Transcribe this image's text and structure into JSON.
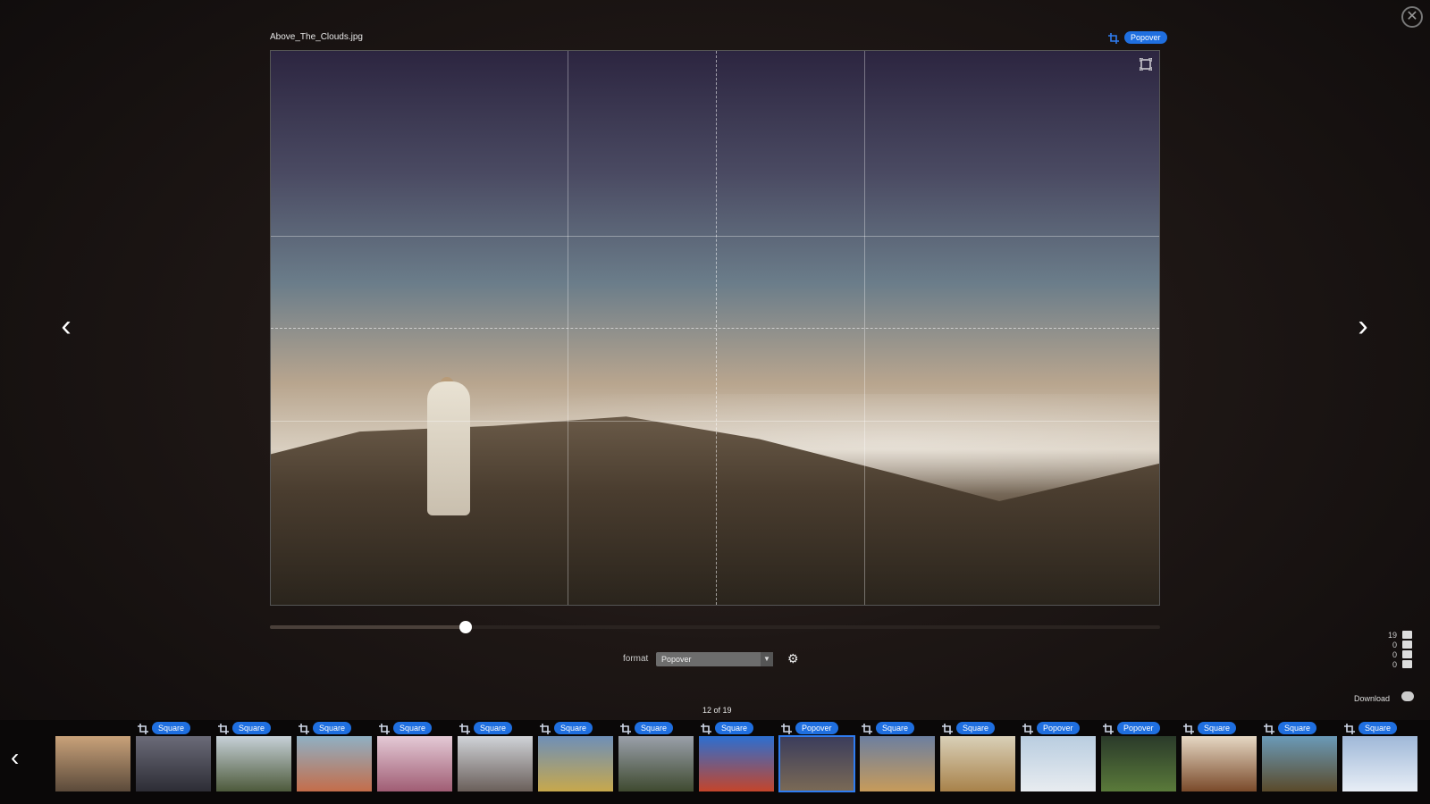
{
  "filename": "Above_The_Clouds.jpg",
  "current_format": "Popover",
  "format_label": "format",
  "format_select_value": "Popover",
  "zoom_value": 0.22,
  "stats": [
    {
      "count": "19",
      "icon": "image-icon"
    },
    {
      "count": "0",
      "icon": "audio-icon"
    },
    {
      "count": "0",
      "icon": "camera-icon"
    },
    {
      "count": "0",
      "icon": "document-icon"
    }
  ],
  "download_label": "Download",
  "counter": "12 of 19",
  "filmstrip": [
    {
      "tag": "",
      "colors": [
        "#c9a27a",
        "#5b4a3a"
      ]
    },
    {
      "tag": "Square",
      "colors": [
        "#6b6b78",
        "#2d2d35"
      ]
    },
    {
      "tag": "Square",
      "colors": [
        "#c7d1d8",
        "#4d5a3b"
      ]
    },
    {
      "tag": "Square",
      "colors": [
        "#8fb0c4",
        "#c46d4a"
      ]
    },
    {
      "tag": "Square",
      "colors": [
        "#e4cad6",
        "#a05d74"
      ]
    },
    {
      "tag": "Square",
      "colors": [
        "#d0d3d8",
        "#6a5f5a"
      ]
    },
    {
      "tag": "Square",
      "colors": [
        "#6e8fb8",
        "#c7a84c"
      ]
    },
    {
      "tag": "Square",
      "colors": [
        "#9aa0aa",
        "#3f4a30"
      ]
    },
    {
      "tag": "Square",
      "colors": [
        "#2c6fd1",
        "#c4452b"
      ]
    },
    {
      "tag": "Popover",
      "colors": [
        "#3a3c5c",
        "#7b6a55"
      ],
      "active": true
    },
    {
      "tag": "Square",
      "colors": [
        "#6c7fa0",
        "#c79b5a"
      ]
    },
    {
      "tag": "Square",
      "colors": [
        "#d9d0b8",
        "#a8824a"
      ]
    },
    {
      "tag": "Popover",
      "colors": [
        "#b9cde0",
        "#e8ecf0"
      ]
    },
    {
      "tag": "Popover",
      "colors": [
        "#2a3a2a",
        "#5a7a3a"
      ]
    },
    {
      "tag": "Square",
      "colors": [
        "#e6d8c4",
        "#7a4a2a"
      ]
    },
    {
      "tag": "Square",
      "colors": [
        "#6a9ab8",
        "#5a4a2a"
      ]
    },
    {
      "tag": "Square",
      "colors": [
        "#9fb8d8",
        "#e8eef6"
      ]
    }
  ],
  "colors": {
    "accent": "#1f6fe0"
  }
}
